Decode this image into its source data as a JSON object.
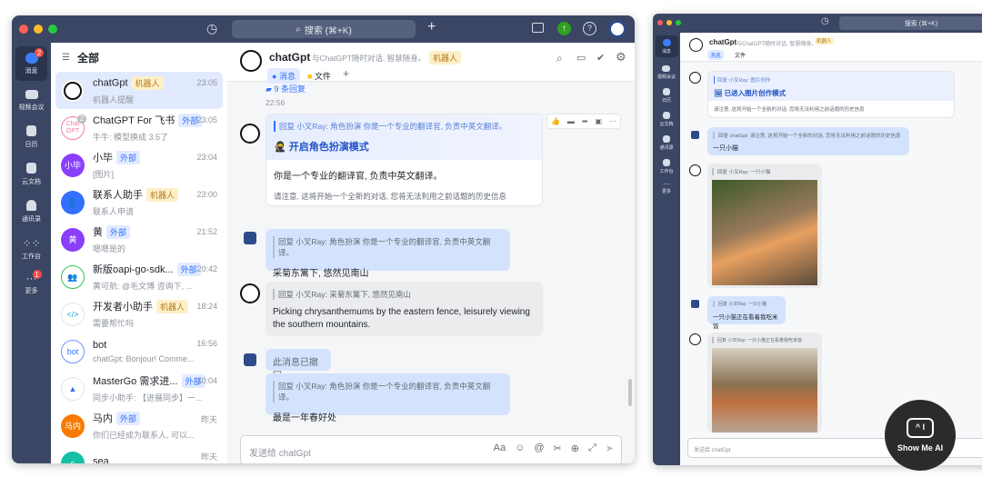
{
  "search": {
    "placeholder": "搜索 (⌘+K)"
  },
  "nav": [
    {
      "label": "消息",
      "badge": "2"
    },
    {
      "label": "视频会议"
    },
    {
      "label": "日历"
    },
    {
      "label": "云文档"
    },
    {
      "label": "通讯录"
    },
    {
      "label": "工作台"
    },
    {
      "label": "更多",
      "badge": "1"
    }
  ],
  "list": {
    "title": "全部",
    "items": [
      {
        "name": "chatGpt",
        "tag": "机器人",
        "tagType": "bot",
        "sub": "机器人提醒",
        "time": "23:05",
        "avatar": "",
        "color": "#ffffff"
      },
      {
        "name": "ChatGPT For 飞书",
        "tag": "外部",
        "tagType": "ext",
        "sub": "牛牛: 模型换成 3.5了",
        "time": "23:05",
        "avatar": "Chat GPT",
        "color": "#ffffff",
        "badge": "2"
      },
      {
        "name": "小毕",
        "tag": "外部",
        "tagType": "ext",
        "sub": "[图片]",
        "time": "23:04",
        "avatar": "小毕",
        "color": "#8a3ffc"
      },
      {
        "name": "联系人助手",
        "tag": "机器人",
        "tagType": "bot",
        "sub": "联系人申请",
        "time": "23:00",
        "avatar": "👤",
        "color": "#3370ff"
      },
      {
        "name": "黄",
        "tag": "外部",
        "tagType": "ext",
        "sub": "嗯嗯是的",
        "time": "21:52",
        "avatar": "黄",
        "color": "#8a3ffc"
      },
      {
        "name": "新版oapi-go-sdk...",
        "tag": "外部",
        "tagType": "ext",
        "sub": "黄可航: @毛文博 咨询下, ...",
        "time": "20:42",
        "avatar": "👥",
        "color": "#ffffff"
      },
      {
        "name": "开发者小助手",
        "tag": "机器人",
        "tagType": "bot",
        "sub": "需要帮忙吗",
        "time": "18:24",
        "avatar": "</>",
        "color": "#ffffff"
      },
      {
        "name": "bot",
        "tag": "",
        "tagType": "",
        "sub": "chatGpt: Bonjour! Comme...",
        "time": "16:56",
        "avatar": "bot",
        "color": "#ffffff"
      },
      {
        "name": "MasterGo 需求进...",
        "tag": "外部",
        "tagType": "ext",
        "sub": "同步小助手: 【进展同步】一...",
        "time": "10:04",
        "avatar": "▲",
        "color": "#ffffff"
      },
      {
        "name": "马内",
        "tag": "外部",
        "tagType": "ext",
        "sub": "你们已经成为联系人, 可以...",
        "time": "昨天",
        "avatar": "马内",
        "color": "#f77b00"
      },
      {
        "name": "sea",
        "tag": "",
        "tagType": "",
        "sub": "",
        "time": "昨天",
        "avatar": "s",
        "color": "#14c0a6"
      }
    ]
  },
  "chat": {
    "name": "chatGpt",
    "desc": "与ChatGPT随时对话, 智慧随身。",
    "tag": "机器人",
    "tabs": [
      "消息",
      "文件"
    ],
    "replies": "9 条回复",
    "time": "22:56",
    "card": {
      "quote": "回复 小叉Ray: 角色扮演 你是一个专业的翻译官, 负责中英文翻译。",
      "title": "开启角色扮演模式",
      "body": "你是一个专业的翻译官, 负责中英文翻译。",
      "note": "请注意, 这将开始一个全新的对话, 您将无法利用之前话题的历史信息"
    },
    "m1": {
      "quote": "回复 小叉Ray: 角色扮演 你是一个专业的翻译官, 负责中英文翻译。",
      "text": "采菊东篱下, 悠然见南山"
    },
    "m2": {
      "quote": "回复 小叉Ray: 采菊东篱下, 悠然见南山",
      "text": "Picking chrysanthemums by the eastern fence, leisurely viewing the southern mountains."
    },
    "m3": {
      "text": "此消息已撤回"
    },
    "m4": {
      "quote": "回复 小叉Ray: 角色扮演 你是一个专业的翻译官, 负责中英文翻译。",
      "text": "最是一年春好处"
    },
    "input": {
      "placeholder": "发送给 chatGpt"
    }
  },
  "chat2": {
    "name": "chatGpt",
    "desc": "与ChatGPT随时对话, 智慧随身。",
    "tag": "机器人",
    "tabs": [
      "消息",
      "文件"
    ],
    "card": {
      "quote": "回复 小叉Ray: 图片创作",
      "title": "已进入图片创作模式",
      "note": "请注意, 这将开始一个全新的对话, 您将无法利用之前话题的历史信息"
    },
    "m1": {
      "quote": "回复 chatGpt: 请注意, 这将开始一个全新的对话, 您将无法利用之前话题的历史信息",
      "text": "一只小猫"
    },
    "m2": {
      "quote": "回复 小叉Ray: 一只小猫"
    },
    "m3": {
      "quote": "回复 小叉Ray: 一只小猫",
      "text": "一只小猫正在看着我吃米饭"
    },
    "m4": {
      "quote": "回复 小叉Ray: 一只小猫正在看着我吃米饭"
    },
    "input": {
      "placeholder": "发送给 chatGpt"
    }
  },
  "watermark": "Show Me AI"
}
